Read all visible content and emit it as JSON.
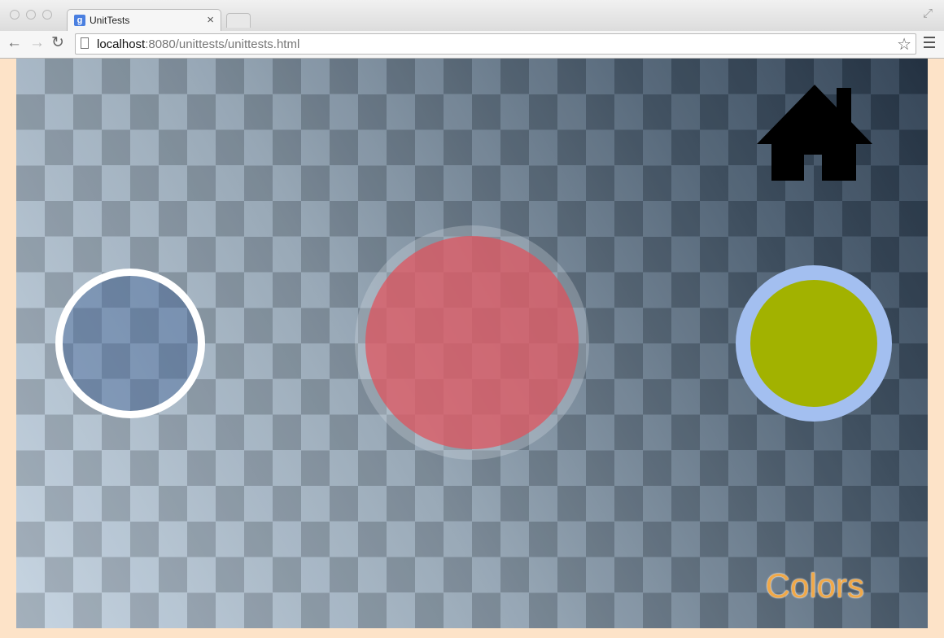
{
  "browser": {
    "tab_title": "UnitTests",
    "tab_close": "×",
    "favicon_letter": "g",
    "url_host": "localhost",
    "url_rest": ":8080/unittests/unittests.html",
    "nav": {
      "back": "←",
      "forward": "→",
      "reload": "↻"
    },
    "star": "☆",
    "fullscreen": "⤢"
  },
  "page": {
    "home_icon": "home-icon",
    "colors_label": "Colors",
    "circles": [
      {
        "name": "blue-circle",
        "fill": "#5b7699",
        "ring": "#ffffff"
      },
      {
        "name": "red-circle",
        "fill": "#c55f67",
        "ring": "#c8ced8"
      },
      {
        "name": "green-circle",
        "fill": "#a2b200",
        "ring": "#a3bff0"
      }
    ],
    "colors": {
      "page_background": "#fde3c8",
      "house": "#000000",
      "label": "#f0a848"
    }
  }
}
